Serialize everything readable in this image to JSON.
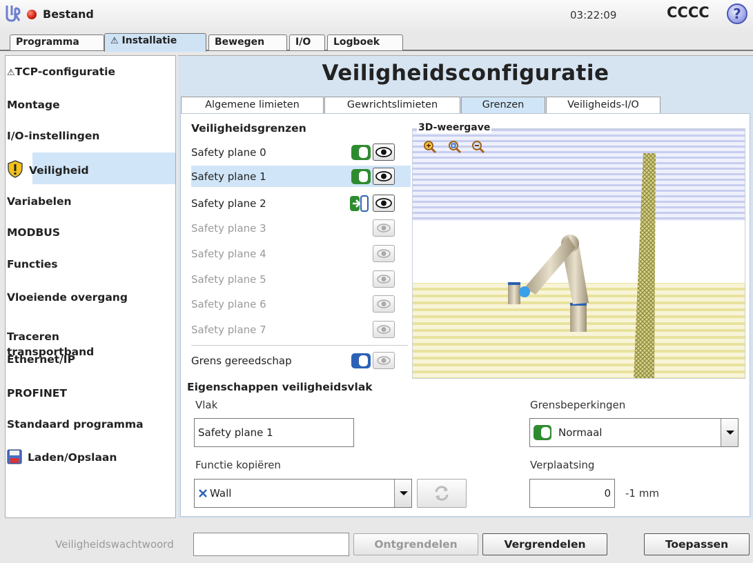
{
  "header": {
    "app_title": "Bestand",
    "clock": "03:22:09",
    "robot_name": "CCCC",
    "help_symbol": "?"
  },
  "main_tabs": [
    {
      "label": "Programma"
    },
    {
      "label": "Installatie",
      "warning": true,
      "active": true
    },
    {
      "label": "Bewegen"
    },
    {
      "label": "I/O"
    },
    {
      "label": "Logboek"
    }
  ],
  "sidebar": {
    "items": [
      {
        "label": "TCP-configuratie",
        "icon": "warning-icon"
      },
      {
        "label": "Montage"
      },
      {
        "label": "I/O-instellingen"
      },
      {
        "label": "Veiligheid",
        "icon": "shield-warning-icon",
        "selected": true
      },
      {
        "label": "Variabelen"
      },
      {
        "label": "MODBUS"
      },
      {
        "label": "Functies"
      },
      {
        "label": "Vloeiende overgang"
      },
      {
        "label": "Traceren\ntransportband"
      },
      {
        "label": "Ethernet/IP"
      },
      {
        "label": "PROFINET"
      },
      {
        "label": "Standaard programma"
      },
      {
        "label": "Laden/Opslaan",
        "icon": "floppy-disk-icon"
      }
    ]
  },
  "page_title": "Veiligheidsconfiguratie",
  "sub_tabs": [
    {
      "label": "Algemene limieten"
    },
    {
      "label": "Gewrichtslimieten"
    },
    {
      "label": "Grenzen",
      "active": true
    },
    {
      "label": "Veiligheids-I/O"
    }
  ],
  "boundaries": {
    "title": "Veiligheidsgrenzen",
    "planes": [
      {
        "label": "Safety plane 0",
        "enabled": true,
        "mode": "normal"
      },
      {
        "label": "Safety plane 1",
        "enabled": true,
        "mode": "normal",
        "selected": true
      },
      {
        "label": "Safety plane 2",
        "enabled": true,
        "mode": "trigger"
      },
      {
        "label": "Safety plane 3",
        "enabled": false
      },
      {
        "label": "Safety plane 4",
        "enabled": false
      },
      {
        "label": "Safety plane 5",
        "enabled": false
      },
      {
        "label": "Safety plane 6",
        "enabled": false
      },
      {
        "label": "Safety plane 7",
        "enabled": false
      }
    ],
    "tool_boundary": "Grens gereedschap"
  },
  "view3d": {
    "title": "3D-weergave"
  },
  "properties": {
    "title": "Eigenschappen veiligheidsvlak",
    "plane_label": "Vlak",
    "plane_value": "Safety plane 1",
    "copy_label": "Functie kopiëren",
    "copy_value": "Wall",
    "restriction_label": "Grensbeperkingen",
    "restriction_value": "Normaal",
    "displacement_label": "Verplaatsing",
    "displacement_value": "0",
    "displacement_unit": "-1 mm"
  },
  "footer": {
    "password_placeholder": "Veiligheidswachtwoord",
    "unlock_label": "Ontgrendelen",
    "lock_label": "Vergrendelen",
    "apply_label": "Toepassen"
  },
  "colors": {
    "accent_blue": "#d0e5f7",
    "toggle_green": "#2f8b2f",
    "toggle_blue": "#2b62b5",
    "status_red": "#d11a0a"
  }
}
